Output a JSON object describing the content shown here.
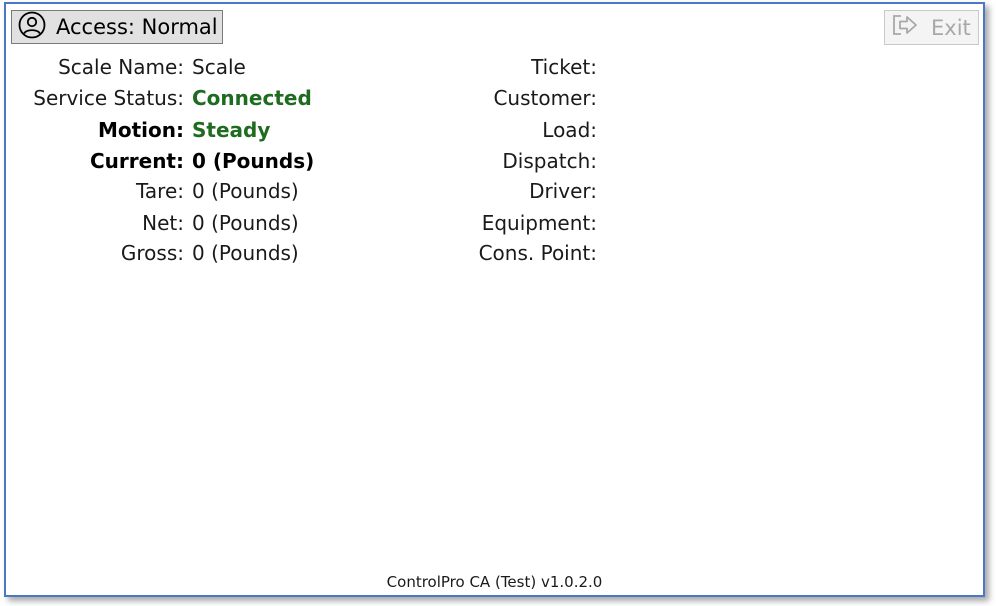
{
  "header": {
    "access_label": "Access: Normal",
    "exit_label": "Exit"
  },
  "scale_fields": [
    {
      "label": "Scale Name:",
      "value": "Scale"
    },
    {
      "label": "Service Status:",
      "value": "Connected"
    },
    {
      "label": "Motion:",
      "value": "Steady"
    },
    {
      "label": "Current:",
      "value": "0 (Pounds)"
    },
    {
      "label": "Tare:",
      "value": "0 (Pounds)"
    },
    {
      "label": "Net:",
      "value": "0 (Pounds)"
    },
    {
      "label": "Gross:",
      "value": "0 (Pounds)"
    }
  ],
  "ticket_fields": [
    {
      "label": "Ticket:",
      "value": ""
    },
    {
      "label": "Customer:",
      "value": ""
    },
    {
      "label": "Load:",
      "value": ""
    },
    {
      "label": "Dispatch:",
      "value": ""
    },
    {
      "label": "Driver:",
      "value": ""
    },
    {
      "label": "Equipment:",
      "value": ""
    },
    {
      "label": "Cons. Point:",
      "value": ""
    }
  ],
  "footer": {
    "version_text": "ControlPro CA (Test) v1.0.2.0"
  },
  "colors": {
    "status_green": "#1f6b1f",
    "window_border": "#4a78c2"
  },
  "icons": {
    "access": "user-circle-icon",
    "exit": "exit-arrow-icon"
  }
}
